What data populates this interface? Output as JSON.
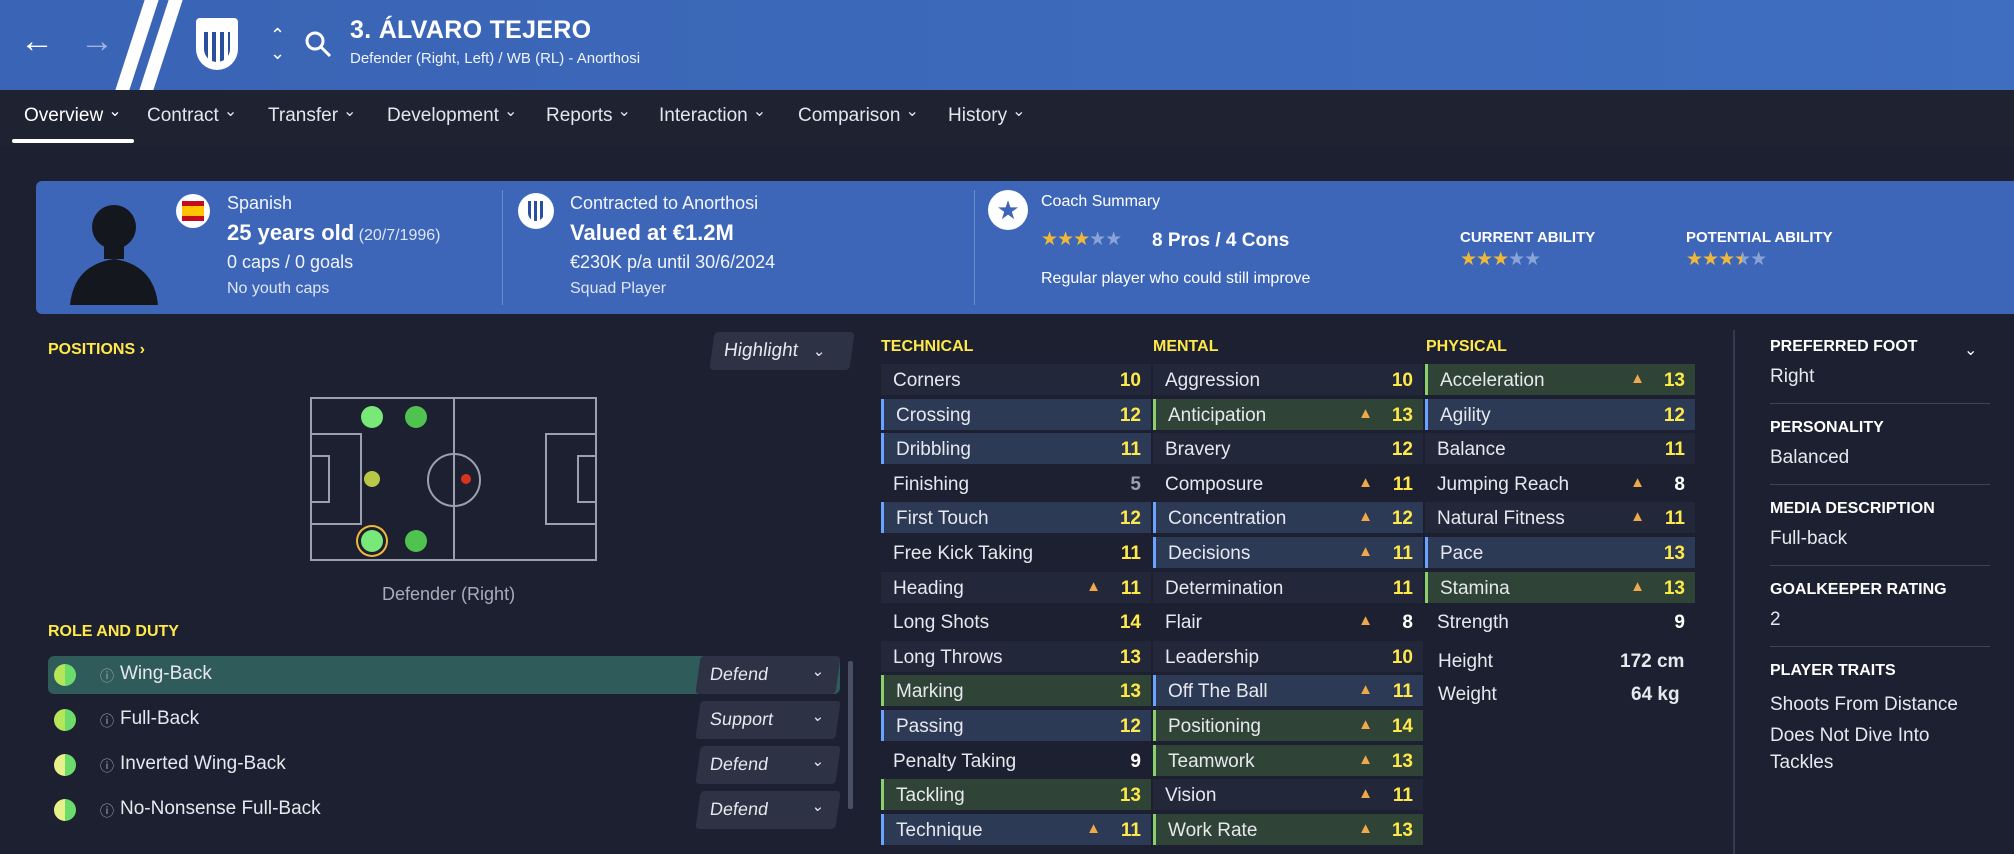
{
  "header": {
    "title": "3. ÁLVARO TEJERO",
    "subtitle": "Defender (Right, Left) / WB (RL) - Anorthosi",
    "back_icon": "arrow-left-icon",
    "forward_icon": "arrow-right-icon",
    "search_icon": "search-icon",
    "accent": "#3d66b8"
  },
  "tabs": [
    "Overview",
    "Contract",
    "Transfer",
    "Development",
    "Reports",
    "Interaction",
    "Comparison",
    "History"
  ],
  "summary": {
    "nationality": "Spanish",
    "age": "25 years old",
    "dob": "(20/7/1996)",
    "caps": "0 caps / 0 goals",
    "youth": "No youth caps",
    "contract_to": "Contracted to Anorthosi",
    "value": "Valued at €1.2M",
    "wage": "€230K p/a until 30/6/2024",
    "squad": "Squad Player",
    "coach_title": "Coach Summary",
    "pros_cons": "8 Pros / 4 Cons",
    "coach_note": "Regular player who could still improve",
    "coach_stars": 3,
    "ca_label": "CURRENT ABILITY",
    "ca_stars": 3,
    "pa_label": "POTENTIAL ABILITY",
    "pa_stars": 3.5
  },
  "positions": {
    "title": "POSITIONS",
    "highlight": "Highlight",
    "caption": "Defender (Right)"
  },
  "role": {
    "title": "ROLE AND DUTY",
    "rows": [
      {
        "name": "Wing-Back",
        "duty": "Defend"
      },
      {
        "name": "Full-Back",
        "duty": "Support"
      },
      {
        "name": "Inverted Wing-Back",
        "duty": "Defend"
      },
      {
        "name": "No-Nonsense Full-Back",
        "duty": "Defend"
      }
    ]
  },
  "attributes": {
    "technical_title": "TECHNICAL",
    "mental_title": "MENTAL",
    "physical_title": "PHYSICAL",
    "technical": [
      {
        "n": "Corners",
        "v": "10"
      },
      {
        "n": "Crossing",
        "v": "12",
        "h": "b"
      },
      {
        "n": "Dribbling",
        "v": "11",
        "h": "b"
      },
      {
        "n": "Finishing",
        "v": "5"
      },
      {
        "n": "First Touch",
        "v": "12",
        "h": "b"
      },
      {
        "n": "Free Kick Taking",
        "v": "11"
      },
      {
        "n": "Heading",
        "v": "11",
        "up": true
      },
      {
        "n": "Long Shots",
        "v": "14"
      },
      {
        "n": "Long Throws",
        "v": "13"
      },
      {
        "n": "Marking",
        "v": "13",
        "h": "g"
      },
      {
        "n": "Passing",
        "v": "12",
        "h": "b"
      },
      {
        "n": "Penalty Taking",
        "v": "9"
      },
      {
        "n": "Tackling",
        "v": "13",
        "h": "g"
      },
      {
        "n": "Technique",
        "v": "11",
        "up": true,
        "h": "b"
      }
    ],
    "mental": [
      {
        "n": "Aggression",
        "v": "10"
      },
      {
        "n": "Anticipation",
        "v": "13",
        "up": true,
        "h": "g"
      },
      {
        "n": "Bravery",
        "v": "12"
      },
      {
        "n": "Composure",
        "v": "11",
        "up": true
      },
      {
        "n": "Concentration",
        "v": "12",
        "up": true,
        "h": "b"
      },
      {
        "n": "Decisions",
        "v": "11",
        "up": true,
        "h": "b"
      },
      {
        "n": "Determination",
        "v": "11"
      },
      {
        "n": "Flair",
        "v": "8",
        "up": true
      },
      {
        "n": "Leadership",
        "v": "10"
      },
      {
        "n": "Off The Ball",
        "v": "11",
        "up": true,
        "h": "b"
      },
      {
        "n": "Positioning",
        "v": "14",
        "up": true,
        "h": "g"
      },
      {
        "n": "Teamwork",
        "v": "13",
        "up": true,
        "h": "g"
      },
      {
        "n": "Vision",
        "v": "11",
        "up": true
      },
      {
        "n": "Work Rate",
        "v": "13",
        "up": true,
        "h": "g"
      }
    ],
    "physical": [
      {
        "n": "Acceleration",
        "v": "13",
        "up": true,
        "h": "g"
      },
      {
        "n": "Agility",
        "v": "12",
        "h": "b"
      },
      {
        "n": "Balance",
        "v": "11"
      },
      {
        "n": "Jumping Reach",
        "v": "8",
        "up": true
      },
      {
        "n": "Natural Fitness",
        "v": "11",
        "up": true
      },
      {
        "n": "Pace",
        "v": "13",
        "h": "b"
      },
      {
        "n": "Stamina",
        "v": "13",
        "up": true,
        "h": "g"
      },
      {
        "n": "Strength",
        "v": "9"
      }
    ],
    "height_label": "Height",
    "height": "172 cm",
    "weight_label": "Weight",
    "weight": "64 kg"
  },
  "info": {
    "foot_label": "PREFERRED FOOT",
    "foot": "Right",
    "personality_label": "PERSONALITY",
    "personality": "Balanced",
    "media_label": "MEDIA DESCRIPTION",
    "media": "Full-back",
    "gk_label": "GOALKEEPER RATING",
    "gk": "2",
    "traits_label": "PLAYER TRAITS",
    "traits": [
      "Shoots From Distance",
      "Does Not Dive Into",
      "Tackles"
    ]
  }
}
